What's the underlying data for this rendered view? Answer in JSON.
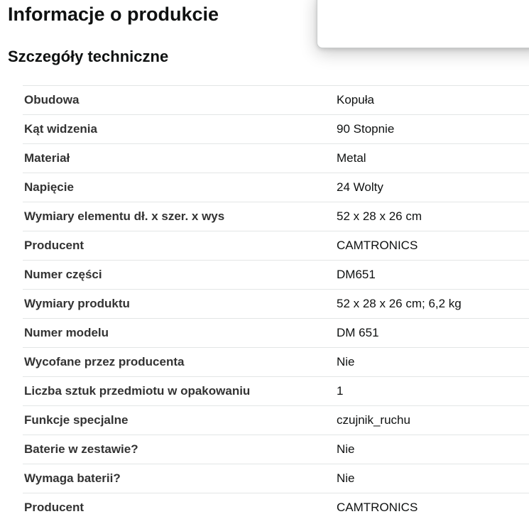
{
  "page": {
    "title": "Informacje o produkcie",
    "section_title": "Szczegóły techniczne"
  },
  "specs": [
    {
      "label": "Obudowa",
      "value": "Kopuła"
    },
    {
      "label": "Kąt widzenia",
      "value": "90 Stopnie"
    },
    {
      "label": "Materiał",
      "value": "Metal"
    },
    {
      "label": "Napięcie",
      "value": "24 Wolty"
    },
    {
      "label": "Wymiary elementu dł. x szer. x wys",
      "value": "52 x 28 x 26 cm"
    },
    {
      "label": "Producent",
      "value": "CAMTRONICS"
    },
    {
      "label": "Numer części",
      "value": "DM651"
    },
    {
      "label": "Wymiary produktu",
      "value": "52 x 28 x 26 cm; 6,2 kg"
    },
    {
      "label": "Numer modelu",
      "value": "DM 651"
    },
    {
      "label": "Wycofane przez producenta",
      "value": "Nie"
    },
    {
      "label": "Liczba sztuk przedmiotu w opakowaniu",
      "value": "1"
    },
    {
      "label": "Funkcje specjalne",
      "value": "czujnik_ruchu"
    },
    {
      "label": "Baterie w zestawie?",
      "value": "Nie"
    },
    {
      "label": "Wymaga baterii?",
      "value": "Nie"
    },
    {
      "label": "Producent",
      "value": "CAMTRONICS"
    }
  ]
}
